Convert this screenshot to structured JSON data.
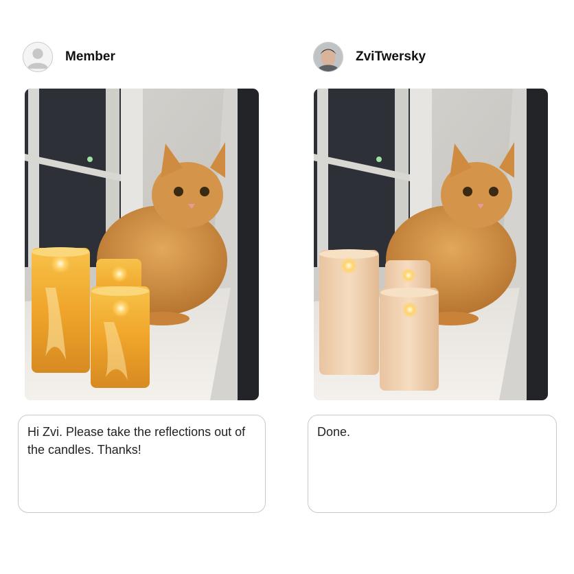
{
  "posts": [
    {
      "username": "Member",
      "avatar_icon": "default-user-icon",
      "image_description_icon": "cat-with-glowing-candles-photo",
      "message": "Hi Zvi. Please take the reflections out of the candles. Thanks!"
    },
    {
      "username": "ZviTwersky",
      "avatar_icon": "profile-photo-icon",
      "image_description_icon": "cat-with-matte-candles-photo",
      "message": "Done."
    }
  ],
  "colors": {
    "border": "#c9c9c9",
    "candle_glow": "#f2b43a",
    "candle_matte": "#f0cfa8",
    "cat_fur": "#d89a45"
  }
}
